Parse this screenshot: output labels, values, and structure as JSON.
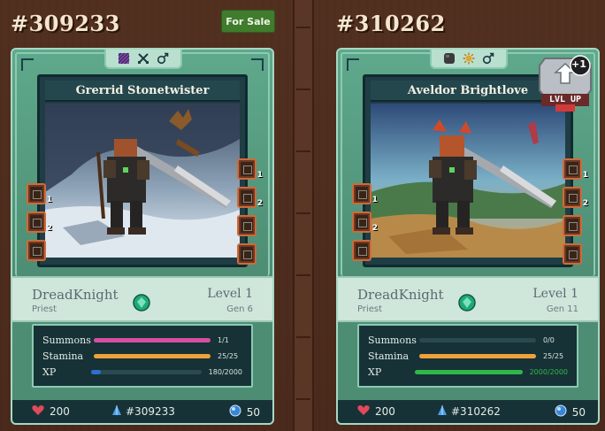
{
  "colors": {
    "summons_bar": "#d64fa2",
    "stamina_bar": "#f0a23a",
    "xp_bar_left": "#2f6fd0",
    "xp_bar_right": "#2fb84a",
    "card_green": "#5ea288",
    "wood_bg": "#4a2a1f"
  },
  "cards": [
    {
      "id_label": "#309233",
      "sale_label": "For Sale",
      "badge_icons": [
        "crosshatch-icon",
        "crossed-swords-icon",
        "male-icon"
      ],
      "hero_name": "Grerrid Stonetwister",
      "class": "DreadKnight",
      "subclass": "Priest",
      "level": "Level 1",
      "gen": "Gen 6",
      "stats": {
        "summons": {
          "label": "Summons",
          "value": "1/1",
          "fraction": 1.0
        },
        "stamina": {
          "label": "Stamina",
          "value": "25/25",
          "fraction": 1.0
        },
        "xp": {
          "label": "XP",
          "value": "180/2000",
          "fraction": 0.09
        }
      },
      "abilities_left_ranks": [
        "1",
        "2",
        ""
      ],
      "abilities_right_ranks": [
        "1",
        "2",
        "",
        ""
      ],
      "hp": "200",
      "footer_id": "#309233",
      "mp": "50"
    },
    {
      "id_label": "#310262",
      "badge_icons": [
        "stone-icon",
        "sun-icon",
        "male-icon"
      ],
      "hero_name": "Aveldor Brightlove",
      "lvlup": {
        "plus": "+1",
        "label": "LVL UP"
      },
      "class": "DreadKnight",
      "subclass": "Priest",
      "level": "Level 1",
      "gen": "Gen 11",
      "stats": {
        "summons": {
          "label": "Summons",
          "value": "0/0",
          "fraction": 0.0
        },
        "stamina": {
          "label": "Stamina",
          "value": "25/25",
          "fraction": 1.0
        },
        "xp": {
          "label": "XP",
          "value": "2000/2000",
          "fraction": 1.0
        }
      },
      "abilities_left_ranks": [
        "1",
        "2",
        ""
      ],
      "abilities_right_ranks": [
        "1",
        "2",
        "",
        ""
      ],
      "hp": "200",
      "footer_id": "#310262",
      "mp": "50"
    }
  ]
}
